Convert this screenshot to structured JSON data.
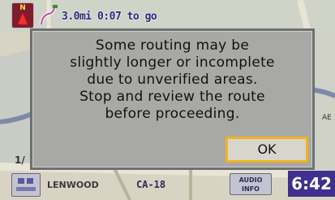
{
  "topbar": {
    "north_label": "N",
    "route_info": "3.0mi 0:07 to go"
  },
  "dialog": {
    "message": "Some routing may be\nslightly longer or incomplete\ndue to unverified areas.\nStop and review the route\nbefore proceeding.",
    "ok_label": "OK"
  },
  "map": {
    "street_left": "LENWOOD",
    "route_shield": "CA-18",
    "side_label": "AE",
    "scale_fragment": "1/"
  },
  "bottombar": {
    "audio_label": "AUDIO\nINFO",
    "clock": "6:42"
  },
  "colors": {
    "dialog_bg": "#a8a9a6",
    "ok_border": "#f2b320",
    "clock_bg": "#3f2f8e"
  }
}
